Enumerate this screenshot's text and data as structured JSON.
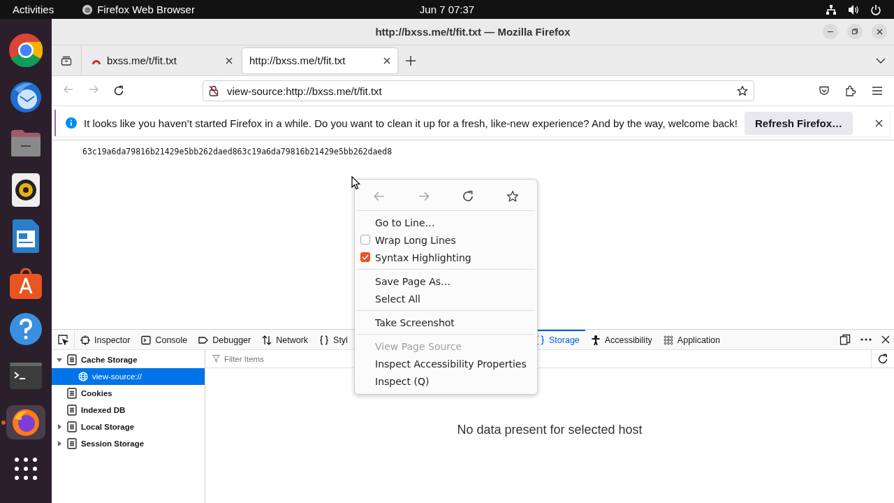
{
  "topbar": {
    "activities": "Activities",
    "app_name": "Firefox Web Browser",
    "clock": "Jun 7  07:37"
  },
  "dock": [
    {
      "kind": "chrome",
      "active": false
    },
    {
      "kind": "mail",
      "active": false
    },
    {
      "kind": "files",
      "active": false
    },
    {
      "kind": "music",
      "active": false
    },
    {
      "kind": "writer",
      "active": false
    },
    {
      "kind": "store",
      "active": false
    },
    {
      "kind": "help",
      "active": false
    },
    {
      "kind": "terminal",
      "active": false
    },
    {
      "kind": "firefox",
      "active": true
    },
    {
      "kind": "apps",
      "active": false
    }
  ],
  "window": {
    "title": "http://bxss.me/t/fit.txt — Mozilla Firefox"
  },
  "tabs": [
    {
      "title": "bxss.me/t/fit.txt",
      "kind": "site",
      "selected": false
    },
    {
      "title": "http://bxss.me/t/fit.txt",
      "kind": "plain",
      "selected": true
    }
  ],
  "address": "view-source:http://bxss.me/t/fit.txt",
  "notification": {
    "message": "It looks like you haven’t started Firefox in a while. Do you want to clean it up for a fresh, like-new experience? And by the way, welcome back!",
    "button": "Refresh Firefox…"
  },
  "source_line": "63c19a6da79816b21429e5bb262daed863c19a6da79816b21429e5bb262daed8",
  "context_menu": {
    "nav": [
      {
        "kind": "back",
        "disabled": true
      },
      {
        "kind": "forward",
        "disabled": true
      },
      {
        "kind": "reload",
        "disabled": false
      },
      {
        "kind": "bookmark",
        "disabled": false
      }
    ],
    "items": [
      {
        "kind": "item",
        "label": "Go to Line…",
        "disabled": false
      },
      {
        "kind": "checkbox",
        "label": "Wrap Long Lines",
        "checked": false,
        "disabled": false
      },
      {
        "kind": "checkbox",
        "label": "Syntax Highlighting",
        "checked": true,
        "disabled": false
      },
      {
        "kind": "separator"
      },
      {
        "kind": "item",
        "label": "Save Page As…",
        "disabled": false
      },
      {
        "kind": "item",
        "label": "Select All",
        "disabled": false
      },
      {
        "kind": "separator"
      },
      {
        "kind": "item",
        "label": "Take Screenshot",
        "disabled": false
      },
      {
        "kind": "separator"
      },
      {
        "kind": "item",
        "label": "View Page Source",
        "disabled": true
      },
      {
        "kind": "item",
        "label": "Inspect Accessibility Properties",
        "disabled": false
      },
      {
        "kind": "item",
        "label": "Inspect (Q)",
        "disabled": false
      }
    ]
  },
  "devtools": {
    "tabs": [
      {
        "kind": "inspector",
        "label": "Inspector",
        "selected": false
      },
      {
        "kind": "console",
        "label": "Console",
        "selected": false
      },
      {
        "kind": "debugger",
        "label": "Debugger",
        "selected": false
      },
      {
        "kind": "network",
        "label": "Network",
        "selected": false
      },
      {
        "kind": "style",
        "label": "Styl",
        "selected": false
      },
      {
        "kind": "storage",
        "label": "Storage",
        "selected": true
      },
      {
        "kind": "accessibility",
        "label": "Accessibility",
        "selected": false
      },
      {
        "kind": "application",
        "label": "Application",
        "selected": false
      }
    ],
    "tree": [
      {
        "label": "Cache Storage",
        "expanded": true,
        "selected": false,
        "children": [
          {
            "label": "view-source://",
            "selected": true
          }
        ]
      },
      {
        "label": "Cookies",
        "selected": false
      },
      {
        "label": "Indexed DB",
        "selected": false
      },
      {
        "label": "Local Storage",
        "expanded": false,
        "selected": false
      },
      {
        "label": "Session Storage",
        "expanded": false,
        "selected": false
      }
    ],
    "filter_placeholder": "Filter Items",
    "empty_message": "No data present for selected host"
  }
}
